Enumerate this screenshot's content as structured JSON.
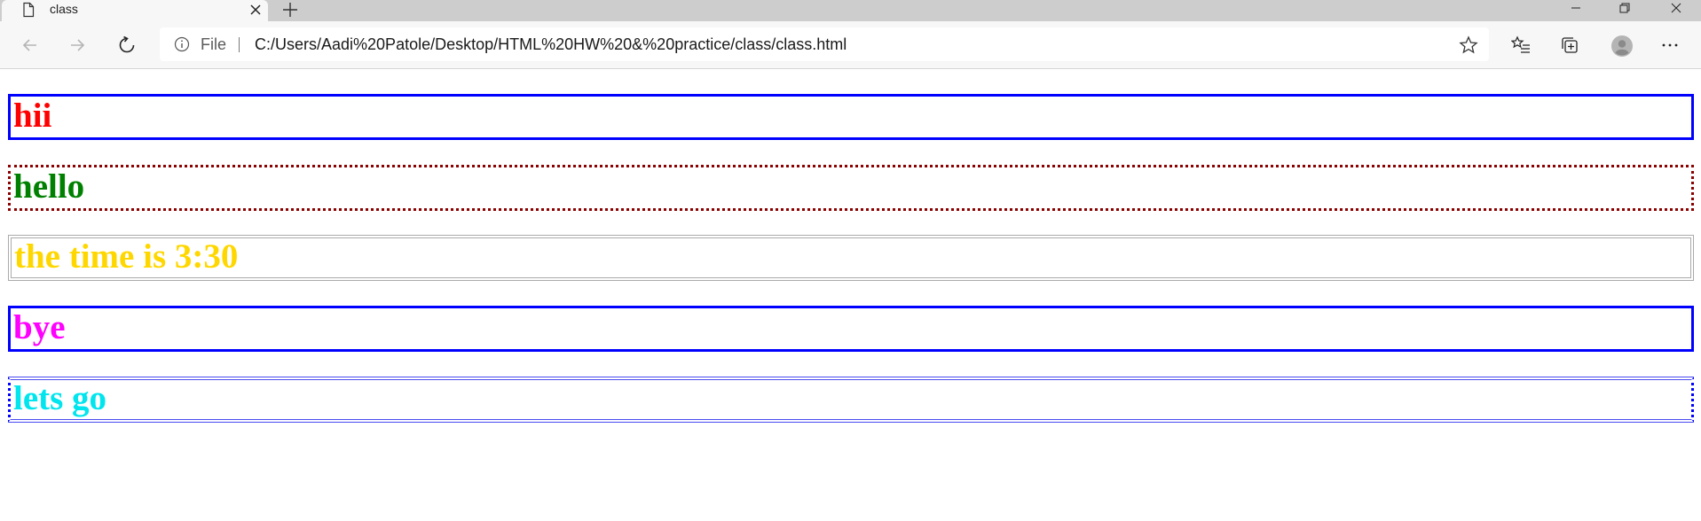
{
  "tab": {
    "title": "class",
    "icon": "document-icon"
  },
  "window_controls": [
    "minimize-icon",
    "restore-icon",
    "close-icon"
  ],
  "toolbar": {
    "back_icon": "back-arrow-icon",
    "forward_icon": "forward-arrow-icon",
    "refresh_icon": "refresh-icon",
    "address": {
      "scheme_label": "File",
      "url": "C:/Users/Aadi%20Patole/Desktop/HTML%20HW%20&%20practice/class/class.html"
    },
    "right_icons": [
      "favorite-star-icon",
      "favorites-list-icon",
      "collections-icon",
      "profile-avatar-icon",
      "more-icon"
    ]
  },
  "page": {
    "boxes": [
      {
        "text": "hii",
        "color": "#ff0000"
      },
      {
        "text": "hello",
        "color": "#008000"
      },
      {
        "text": "the time is 3:30",
        "color": "#ffd700"
      },
      {
        "text": "bye",
        "color": "#ff00ff"
      },
      {
        "text": "lets go",
        "color": "#00e5ee"
      }
    ]
  },
  "colors": {
    "tabstrip": "#cdcdcd",
    "toolbar": "#f7f7f7",
    "border_blue": "#0000ff",
    "border_darkred": "#8b0000",
    "border_gray": "#aaaaaa"
  }
}
